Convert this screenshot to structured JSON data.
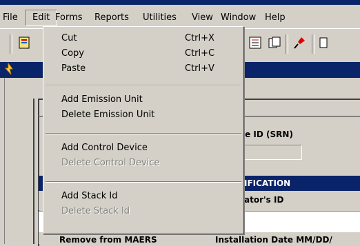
{
  "menubar": {
    "items": [
      "File",
      "Edit",
      "Forms",
      "Reports",
      "Utilities",
      "View",
      "Window",
      "Help"
    ],
    "open_index": 1
  },
  "toolbar": {
    "icons": [
      "open-form-icon",
      "report-icon",
      "notes-icon",
      "copy-forms-icon",
      "pin-icon"
    ]
  },
  "edit_menu": {
    "groups": [
      [
        {
          "label": "Cut",
          "shortcut": "Ctrl+X",
          "enabled": true
        },
        {
          "label": "Copy",
          "shortcut": "Ctrl+C",
          "enabled": true
        },
        {
          "label": "Paste",
          "shortcut": "Ctrl+V",
          "enabled": true
        }
      ],
      [
        {
          "label": "Add Emission Unit",
          "enabled": true
        },
        {
          "label": "Delete Emission Unit",
          "enabled": true
        }
      ],
      [
        {
          "label": "Add Control Device",
          "enabled": true
        },
        {
          "label": "Delete Control Device",
          "enabled": false
        }
      ],
      [
        {
          "label": "Add Stack Id",
          "enabled": true
        },
        {
          "label": "Delete Stack Id",
          "enabled": false
        }
      ]
    ]
  },
  "form": {
    "srn_label": "ce ID (SRN)",
    "section_header": "IFICATION",
    "operator_label": "ator's ID",
    "bottom_left": "Remove from MAERS",
    "bottom_right": "Installation Date MM/DD/"
  },
  "colors": {
    "title_blue": "#0a246a",
    "face": "#d4d0c8"
  }
}
